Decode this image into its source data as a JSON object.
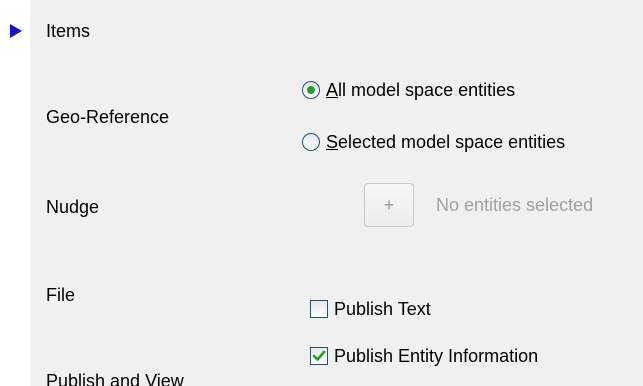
{
  "sections": {
    "items": "Items",
    "geo_reference": "Geo-Reference",
    "nudge": "Nudge",
    "file": "File",
    "publish_and_view": "Publish and View"
  },
  "geo_reference": {
    "options": [
      {
        "key": "A",
        "rest": "ll model space entities",
        "selected": true
      },
      {
        "key": "S",
        "rest": "elected model space entities",
        "selected": false
      }
    ]
  },
  "nudge": {
    "button_label": "+",
    "status": "No entities selected"
  },
  "file": {
    "publish_text": {
      "label": "Publish Text",
      "checked": false
    },
    "publish_entity_info": {
      "label": "Publish Entity Information",
      "checked": true
    }
  },
  "colors": {
    "arrow": "#1414c8",
    "radio_dot": "#21a121",
    "check": "#21a121",
    "disabled_text": "#a0a0a0"
  }
}
